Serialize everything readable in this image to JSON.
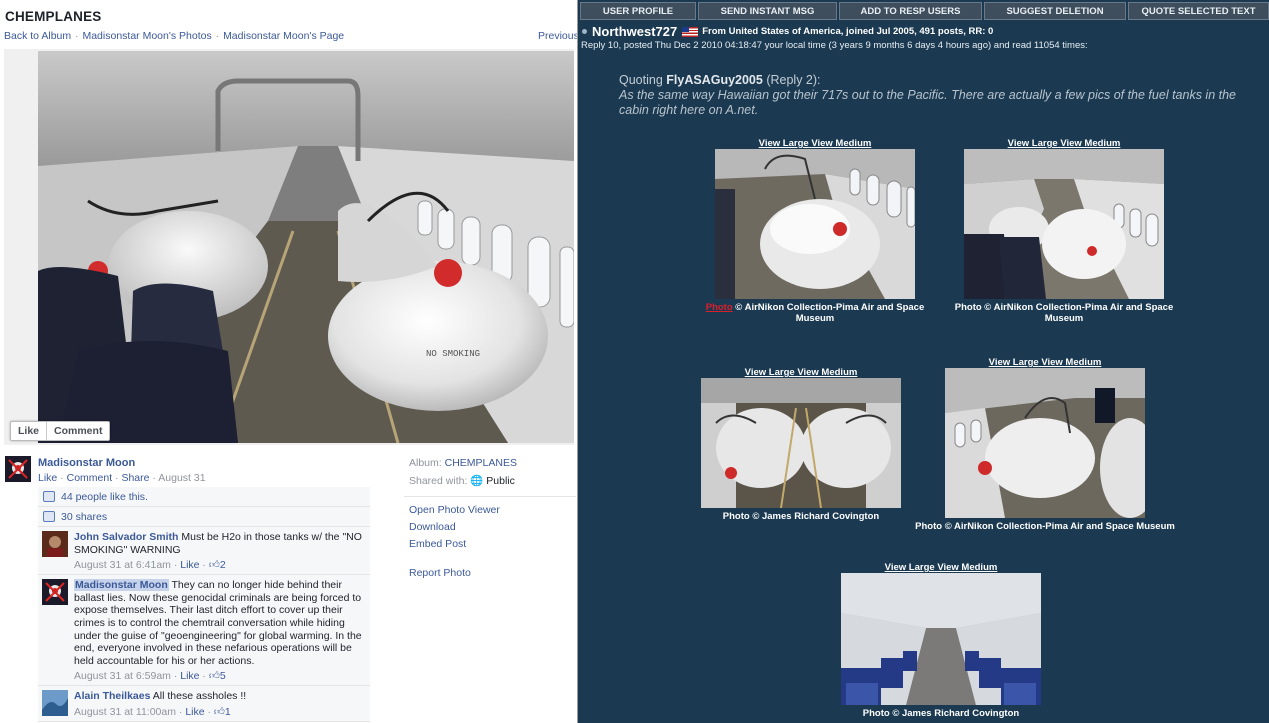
{
  "facebook": {
    "album_title": "CHEMPLANES",
    "breadcrumbs": [
      "Back to Album",
      "Madisonstar Moon's Photos",
      "Madisonstar Moon's Page"
    ],
    "breadcrumb_sep": "·",
    "previous": "Previous",
    "photo_text": "NO SMOKING",
    "actions": {
      "like": "Like",
      "comment": "Comment"
    },
    "poster": {
      "name": "Madisonstar Moon",
      "like": "Like",
      "comment": "Comment",
      "share": "Share",
      "date": "August 31"
    },
    "sidebar": {
      "album_label": "Album:",
      "album_name": "CHEMPLANES",
      "shared_label": "Shared with:",
      "shared_value": "Public",
      "links": [
        "Open Photo Viewer",
        "Download",
        "Embed Post"
      ],
      "report": "Report Photo"
    },
    "likes_text": "44 people like this.",
    "shares_text": "30 shares",
    "comments": [
      {
        "name": "John Salvador Smith",
        "text": "Must be H2o in those tanks w/ the \"NO SMOKING\" WARNING",
        "time": "August 31 at 6:41am",
        "like": "Like",
        "count": "2"
      },
      {
        "name": "Madisonstar Moon",
        "text": "They can no longer hide behind their ballast lies. Now these genocidal criminals are being forced to expose themselves. Their last ditch effort to cover up their crimes is to control the chemtrail conversation while hiding under the guise of \"geoengineering\" for global warming. In the end, everyone involved in these nefarious operations will be held accountable for his or her actions.",
        "time": "August 31 at 6:59am",
        "like": "Like",
        "count": "5"
      },
      {
        "name": "Alain Theilkaes",
        "text": "All these assholes !!",
        "time": "August 31 at 11:00am",
        "like": "Like",
        "count": "1"
      }
    ]
  },
  "forum": {
    "buttons": [
      "USER PROFILE",
      "SEND INSTANT MSG",
      "ADD TO RESP USERS",
      "SUGGEST DELETION",
      "QUOTE SELECTED TEXT"
    ],
    "author": "Northwest727",
    "author_info": "From United States of America, joined Jul 2005, 491 posts, RR: 0",
    "reply_line": "Reply 10, posted Thu Dec 2 2010 04:18:47 your local time (3 years 9 months 6 days 4 hours ago) and read 11054 times:",
    "quote_prefix": "Quoting",
    "quote_user": "FlyASAGuy2005",
    "quote_ref": "(Reply 2):",
    "quote_text": "As the same way Hawaiian got their 717s out to the Pacific. There are actually a few pics of the fuel tanks in the cabin right here on A.net.",
    "view_large": "View Large",
    "view_medium": "View Medium",
    "photos": [
      {
        "caption_link": "Photo",
        "caption": "© AirNikon Collection-Pima Air and Space Museum"
      },
      {
        "caption_link": "",
        "caption": "Photo © AirNikon Collection-Pima Air and Space Museum"
      },
      {
        "caption_link": "",
        "caption": "Photo © James Richard Covington"
      },
      {
        "caption_link": "",
        "caption": "Photo © AirNikon Collection-Pima Air and Space Museum"
      },
      {
        "caption_link": "",
        "caption": "Photo © James Richard Covington"
      }
    ]
  }
}
